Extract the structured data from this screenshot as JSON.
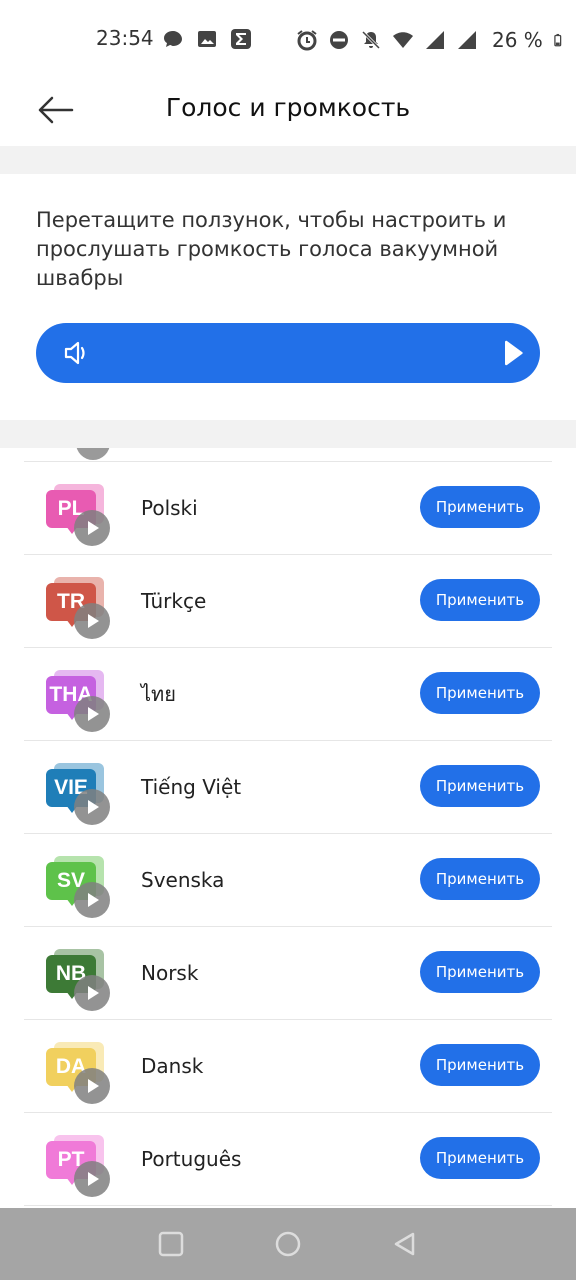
{
  "status_bar": {
    "time": "23:54",
    "battery_text": "26 %",
    "icons_left": [
      "chat-bubble-icon",
      "image-icon",
      "sigma-app-icon"
    ],
    "icons_right": [
      "alarm-icon",
      "do-not-disturb-icon",
      "bell-muted-icon",
      "wifi-icon",
      "signal-icon",
      "signal-icon",
      "battery-icon"
    ]
  },
  "header": {
    "title": "Голос и громкость",
    "back_icon": "arrow-left-icon"
  },
  "volume": {
    "description": "Перетащите ползунок, чтобы настроить и прослушать громкость голоса вакуумной швабры",
    "level": 1.0,
    "speaker_icon": "speaker-icon",
    "play_icon": "play-icon",
    "accent_color": "#2270e8"
  },
  "languages": [
    {
      "code": "PL",
      "name": "Polski",
      "color": "#e85bb2",
      "apply_label": "Применить"
    },
    {
      "code": "TR",
      "name": "Türkçe",
      "color": "#cf5648",
      "apply_label": "Применить"
    },
    {
      "code": "THA",
      "name": "ไทย",
      "color": "#c561e0",
      "apply_label": "Применить"
    },
    {
      "code": "VIE",
      "name": "Tiếng Việt",
      "color": "#1f7eb8",
      "apply_label": "Применить"
    },
    {
      "code": "SV",
      "name": "Svenska",
      "color": "#5ec24a",
      "apply_label": "Применить"
    },
    {
      "code": "NB",
      "name": "Norsk",
      "color": "#3d7a36",
      "apply_label": "Применить"
    },
    {
      "code": "DA",
      "name": "Dansk",
      "color": "#f1d05e",
      "apply_label": "Применить"
    },
    {
      "code": "PT",
      "name": "Português",
      "color": "#f07ad8",
      "apply_label": "Применить"
    }
  ],
  "nav": {
    "recents_icon": "square-icon",
    "home_icon": "circle-icon",
    "back_icon": "triangle-back-icon"
  }
}
